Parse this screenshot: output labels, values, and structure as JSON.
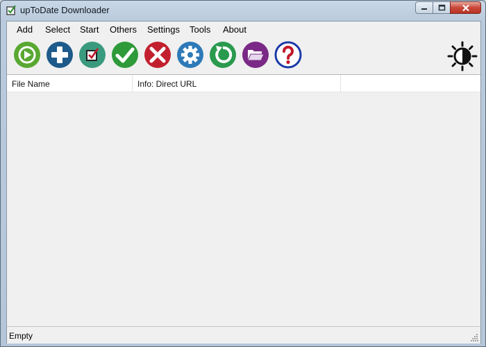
{
  "window": {
    "title": "upToDate Downloader"
  },
  "menu": [
    {
      "label": "Add"
    },
    {
      "label": "Select"
    },
    {
      "label": "Start"
    },
    {
      "label": "Others"
    },
    {
      "label": "Settings"
    },
    {
      "label": "Tools"
    },
    {
      "label": "About"
    }
  ],
  "toolbar": {
    "buttons": [
      {
        "icon": "play-icon",
        "color": "#58a832"
      },
      {
        "icon": "plus-icon",
        "color": "#1e5a8a"
      },
      {
        "icon": "checkbox-icon",
        "color": "#3a9a7e"
      },
      {
        "icon": "checkmark-icon",
        "color": "#2e9a3a"
      },
      {
        "icon": "x-icon",
        "color": "#c2202e"
      },
      {
        "icon": "gear-icon",
        "color": "#2e7ab8"
      },
      {
        "icon": "refresh-icon",
        "color": "#2a9a4e"
      },
      {
        "icon": "folder-icon",
        "color": "#7a2a86"
      },
      {
        "icon": "help-icon",
        "color": "#1a3aa8"
      }
    ],
    "theme_icon": "brightness-icon"
  },
  "list": {
    "columns": [
      {
        "label": "File Name"
      },
      {
        "label": "Info: Direct URL"
      },
      {
        "label": ""
      }
    ]
  },
  "status": {
    "text": "Empty"
  }
}
